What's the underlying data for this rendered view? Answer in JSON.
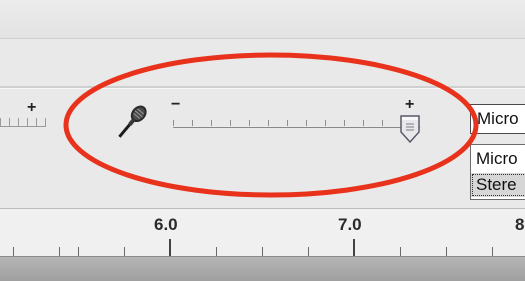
{
  "recording_meter": {
    "left_slider_plus_label": "+",
    "mic_icon": "microphone-icon",
    "slider_min_label": "−",
    "slider_max_label": "+",
    "volume_level": 0.96
  },
  "input_device": {
    "selected_value": "Micro",
    "options": [
      "Micro",
      "Stere"
    ]
  },
  "timeline": {
    "labels": [
      "6.0",
      "7.0",
      "8"
    ]
  },
  "annotation": {
    "color": "#e8321c",
    "shape": "ellipse"
  },
  "colors": {
    "toolbar_bg": "#e9e9e9",
    "ruler_bg": "#f0f0f0",
    "track_bg": "#a8a8a8"
  }
}
